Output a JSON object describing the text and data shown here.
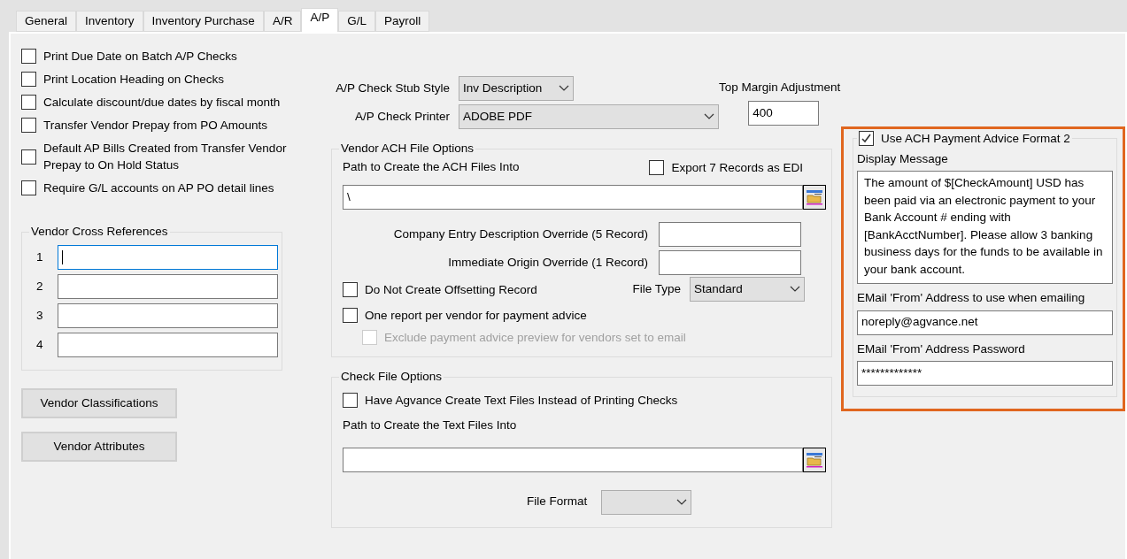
{
  "tabs": [
    {
      "label": "General",
      "selected": false
    },
    {
      "label": "Inventory",
      "selected": false
    },
    {
      "label": "Inventory Purchase",
      "selected": false
    },
    {
      "label": "A/R",
      "selected": false
    },
    {
      "label": "A/P",
      "selected": true
    },
    {
      "label": "G/L",
      "selected": false
    },
    {
      "label": "Payroll",
      "selected": false
    }
  ],
  "options": [
    {
      "label": "Print Due Date on Batch A/P Checks",
      "checked": false
    },
    {
      "label": "Print Location Heading on Checks",
      "checked": false
    },
    {
      "label": "Calculate discount/due dates by fiscal month",
      "checked": false
    },
    {
      "label": "Transfer Vendor Prepay from PO Amounts",
      "checked": false
    },
    {
      "label": "Default AP Bills Created from Transfer Vendor Prepay to On Hold Status",
      "checked": false
    },
    {
      "label": "Require G/L accounts on AP PO detail lines",
      "checked": false
    }
  ],
  "cross_references": {
    "title": "Vendor Cross References",
    "rows": [
      {
        "number": "1",
        "focused": true
      },
      {
        "number": "2",
        "focused": false
      },
      {
        "number": "3",
        "focused": false
      },
      {
        "number": "4",
        "focused": false
      }
    ]
  },
  "buttons": [
    "Vendor Classifications",
    "Vendor Attributes"
  ],
  "stub_style": {
    "label": "A/P Check Stub Style",
    "value": "Inv Description"
  },
  "printer": {
    "label": "A/P Check Printer",
    "value": "ADOBE PDF"
  },
  "top_margin": {
    "label": "Top Margin Adjustment",
    "value": "400"
  },
  "ach": {
    "title": "Vendor ACH File Options",
    "path_label": "Path to Create the ACH Files Into",
    "export_edi": {
      "label": "Export 7 Records as EDI",
      "checked": false
    },
    "path_value": "\\",
    "company_entry": {
      "label": "Company Entry Description Override (5 Record)"
    },
    "immediate_origin": {
      "label": "Immediate Origin Override (1 Record)"
    },
    "offsetting": {
      "label": "Do Not Create Offsetting Record",
      "checked": false
    },
    "file_type": {
      "label": "File Type",
      "value": "Standard"
    },
    "one_report": {
      "label": "One report per vendor for payment advice",
      "checked": false
    },
    "exclude": {
      "label": "Exclude payment advice preview for vendors set to email",
      "checked": false,
      "disabled": true
    }
  },
  "check_file": {
    "title": "Check File Options",
    "create_text": {
      "label": "Have Agvance Create Text Files Instead of Printing Checks",
      "checked": false
    },
    "path_label": "Path to Create the Text Files Into",
    "file_format": {
      "label": "File Format"
    }
  },
  "advice": {
    "use_format2": {
      "label": "Use ACH Payment Advice Format 2",
      "checked": true
    },
    "message_label": "Display Message",
    "message": "The amount of $[CheckAmount] USD has been paid via an electronic payment to your Bank Account # ending with [BankAcctNumber]. Please allow 3 banking business days for the funds to be available in your bank account.",
    "email_label": "EMail 'From' Address to use when emailing",
    "email": "noreply@agvance.net",
    "password_label": "EMail 'From' Address Password",
    "password": "*************"
  }
}
